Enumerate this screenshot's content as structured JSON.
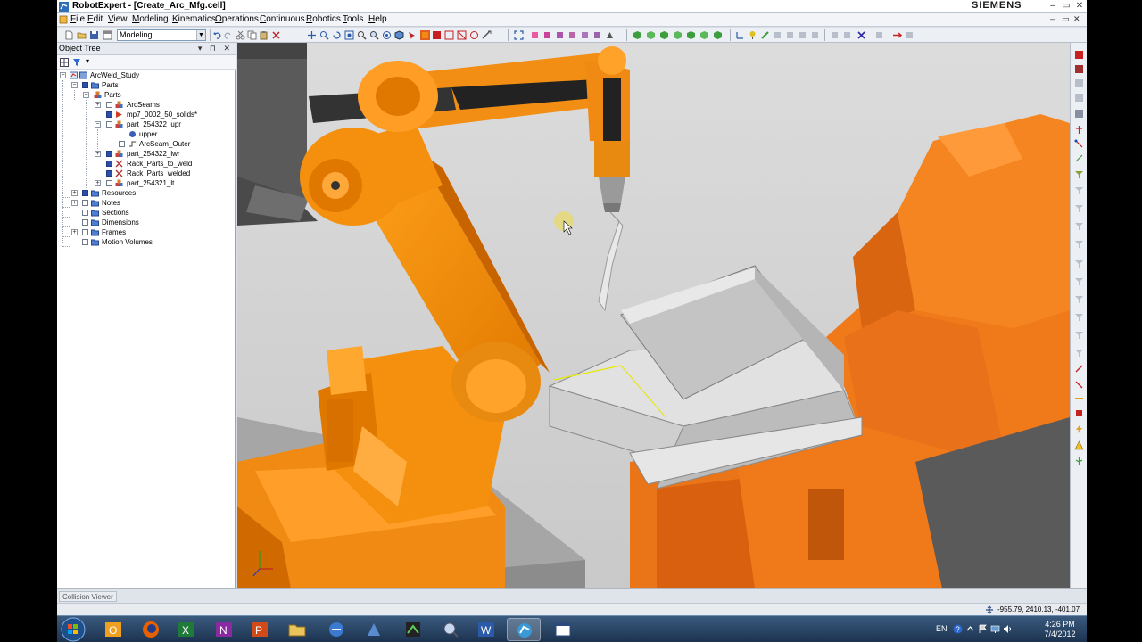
{
  "window": {
    "title": "RobotExpert - [Create_Arc_Mfg.cell]",
    "brand": "SIEMENS",
    "controls": {
      "minimize": "–",
      "restore": "▭",
      "close": "✕"
    }
  },
  "menubar": {
    "items": [
      {
        "label": "File",
        "mnemonic": "F",
        "rest": "ile"
      },
      {
        "label": "Edit",
        "mnemonic": "E",
        "rest": "dit"
      },
      {
        "label": "View",
        "mnemonic": "V",
        "rest": "iew"
      },
      {
        "label": "Modeling",
        "mnemonic": "M",
        "rest": "odeling"
      },
      {
        "label": "Kinematics",
        "mnemonic": "K",
        "rest": "inematics"
      },
      {
        "label": "Operations",
        "mnemonic": "O",
        "rest": "perations"
      },
      {
        "label": "Continuous",
        "mnemonic": "C",
        "rest": "ontinuous"
      },
      {
        "label": "Robotics",
        "mnemonic": "R",
        "rest": "obotics"
      },
      {
        "label": "Tools",
        "mnemonic": "T",
        "rest": "ools"
      },
      {
        "label": "Help",
        "mnemonic": "H",
        "rest": "elp"
      }
    ],
    "mdi_controls": {
      "minimize": "–",
      "restore": "▭",
      "close": "✕"
    }
  },
  "toolbar": {
    "mode_combo_value": "Modeling"
  },
  "object_tree": {
    "title": "Object Tree",
    "controls": "▾ ⊓ ✕",
    "nodes": [
      {
        "label": "ArcWeld_Study",
        "level": 0,
        "expander": "−",
        "icon": "study-icon"
      },
      {
        "label": "Parts",
        "level": 1,
        "expander": "−",
        "icon": "folder-icon",
        "check": "filled"
      },
      {
        "label": "Parts",
        "level": 2,
        "expander": "−",
        "icon": "compound-part-icon"
      },
      {
        "label": "ArcSeams",
        "level": 3,
        "expander": "+",
        "icon": "arcseam-icon",
        "check": "empty"
      },
      {
        "label": "mp7_0002_50_solids*",
        "level": 3,
        "expander": "",
        "icon": "triangle-part-icon",
        "check": "filled"
      },
      {
        "label": "part_254322_upr",
        "level": 3,
        "expander": "−",
        "icon": "part-icon",
        "check": "empty"
      },
      {
        "label": "upper",
        "level": 4,
        "expander": "",
        "icon": "entity-icon"
      },
      {
        "label": "ArcSeam_Outer",
        "level": 4,
        "expander": "",
        "icon": "seam-curve-icon",
        "check": "empty"
      },
      {
        "label": "part_254322_lwr",
        "level": 3,
        "expander": "+",
        "icon": "part-icon",
        "check": "filled"
      },
      {
        "label": "Rack_Parts_to_weld",
        "level": 3,
        "expander": "",
        "icon": "rack-icon",
        "check": "filled"
      },
      {
        "label": "Rack_Parts_welded",
        "level": 3,
        "expander": "",
        "icon": "rack-icon",
        "check": "filled"
      },
      {
        "label": "part_254321_lt",
        "level": 3,
        "expander": "+",
        "icon": "part-icon",
        "check": "empty"
      },
      {
        "label": "Resources",
        "level": 1,
        "expander": "+",
        "icon": "folder-icon",
        "check": "filled"
      },
      {
        "label": "Notes",
        "level": 1,
        "expander": "+",
        "icon": "folder-icon",
        "check": "empty"
      },
      {
        "label": "Sections",
        "level": 1,
        "expander": "",
        "icon": "folder-icon",
        "check": "empty"
      },
      {
        "label": "Dimensions",
        "level": 1,
        "expander": "",
        "icon": "folder-icon",
        "check": "empty"
      },
      {
        "label": "Frames",
        "level": 1,
        "expander": "+",
        "icon": "folder-icon",
        "check": "empty"
      },
      {
        "label": "Motion Volumes",
        "level": 1,
        "expander": "",
        "icon": "folder-icon",
        "check": "empty"
      }
    ]
  },
  "bottom": {
    "collision_viewer": "Collision Viewer"
  },
  "status": {
    "coordinates": "-955.79, 2410.13, -401.07"
  },
  "taskbar": {
    "language": "EN",
    "time": "4:26 PM",
    "date": "7/4/2012"
  },
  "colors": {
    "robot_orange": "#f08a12",
    "viewport_bg": "#d3d3d3",
    "taskbar": "#1c3350",
    "selection_blue": "#2b4ea8"
  }
}
